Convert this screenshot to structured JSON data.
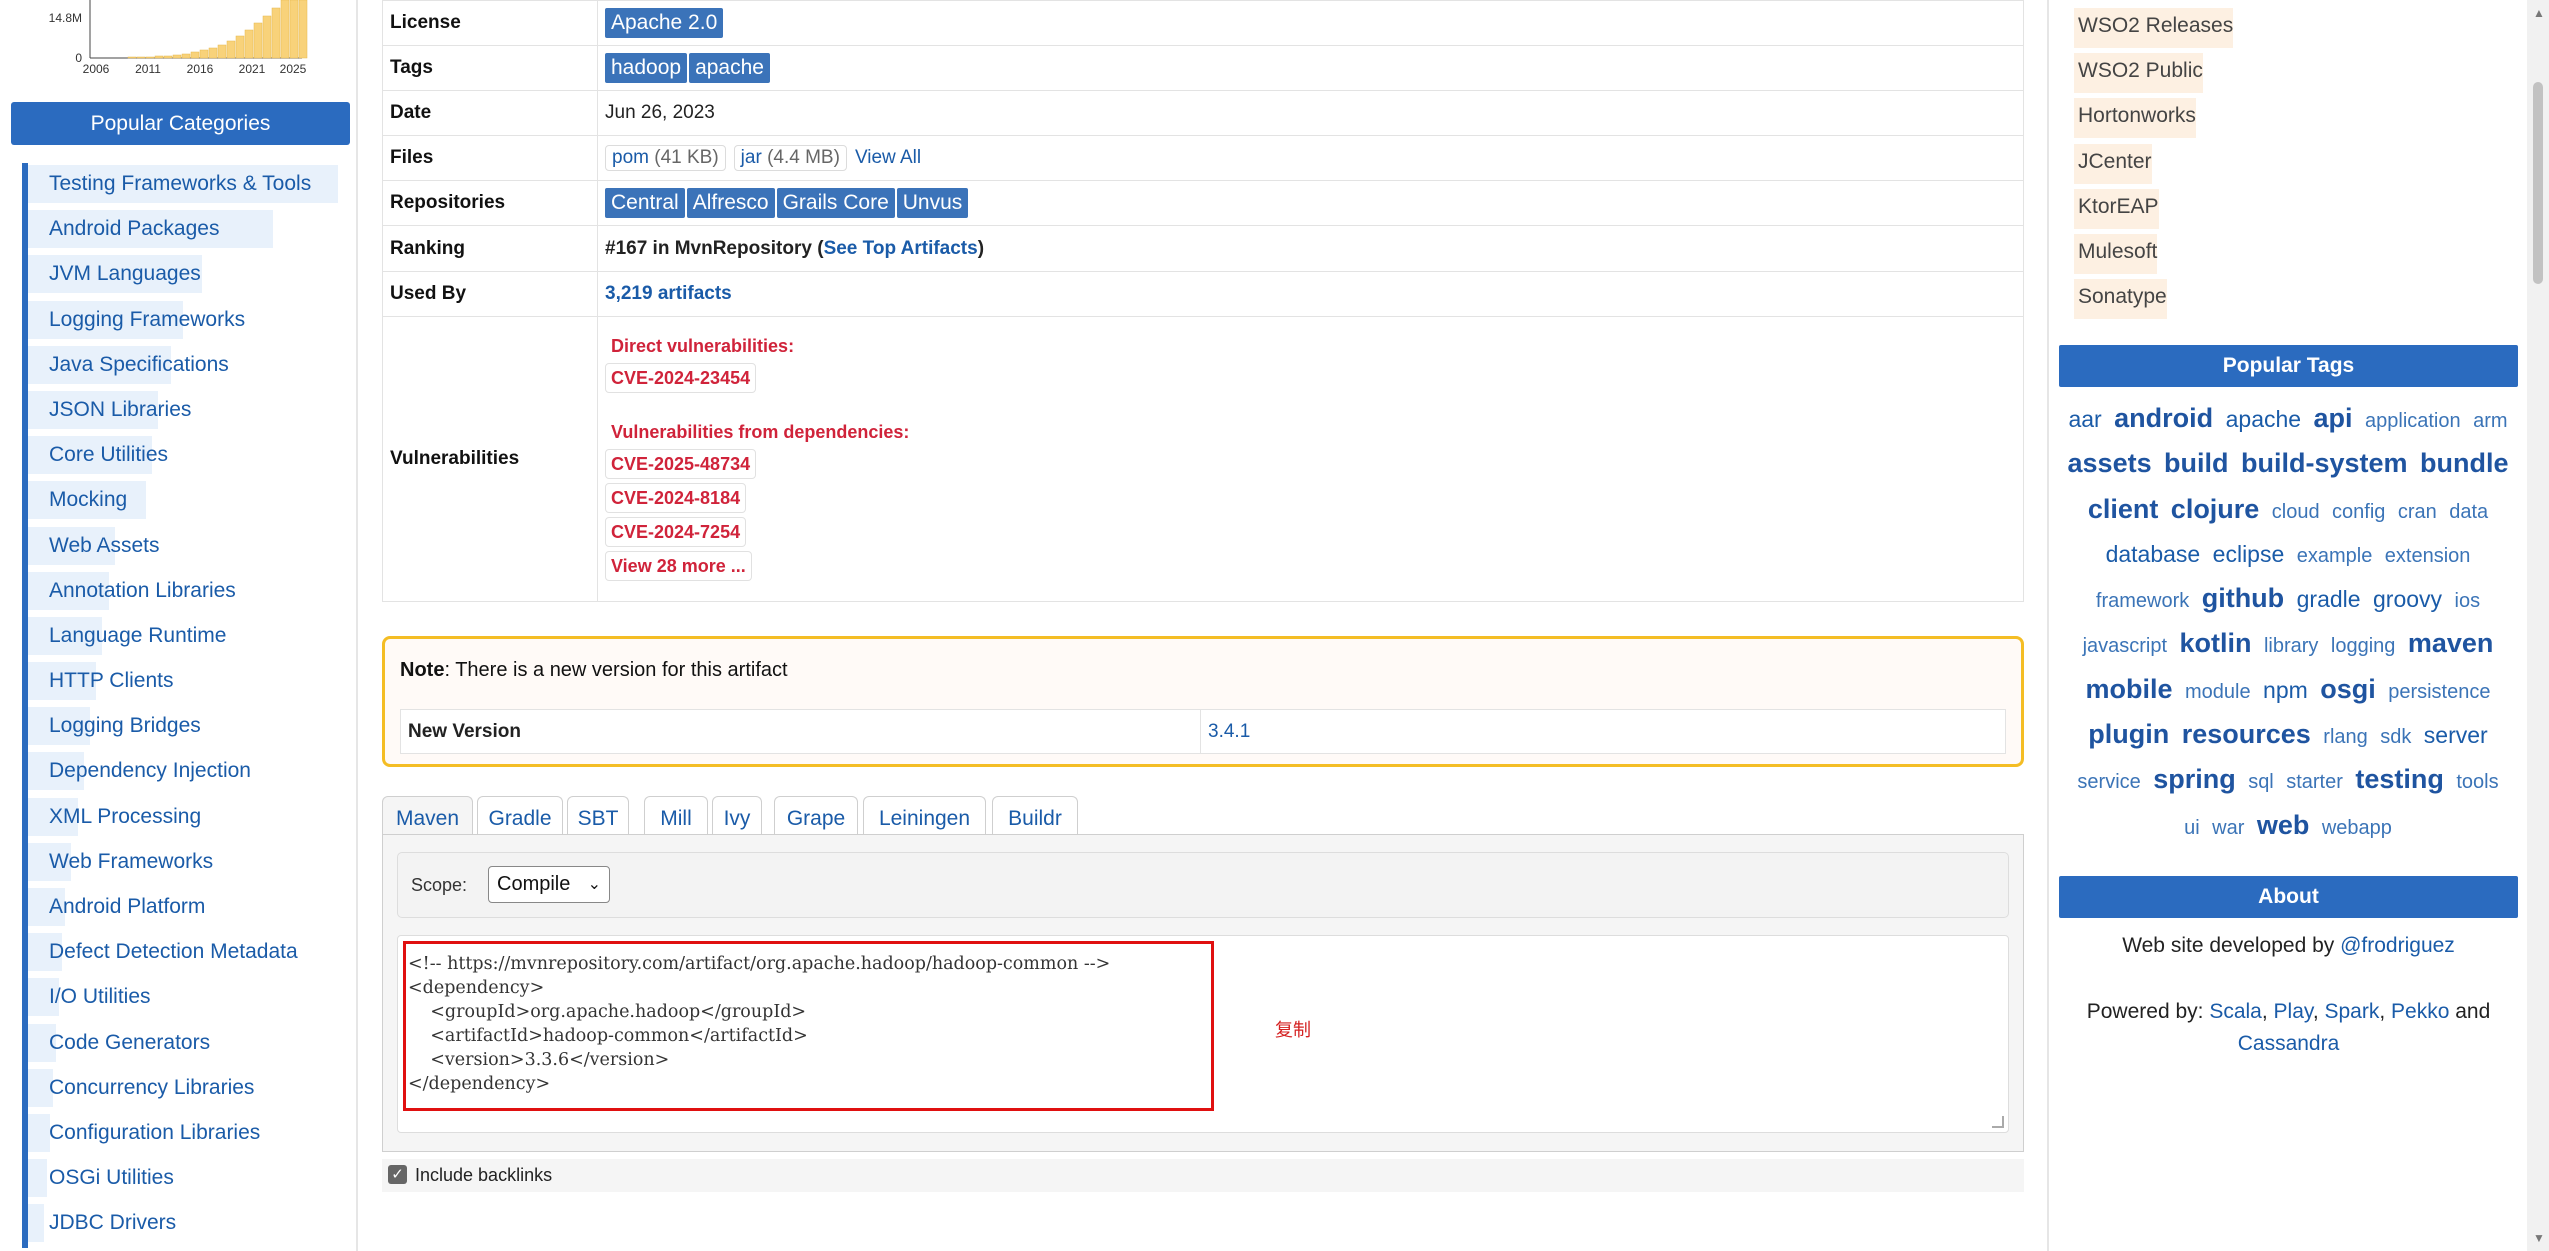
{
  "chart": {
    "ytick_top": "14.8M",
    "ytick_bottom": "0",
    "xticks": [
      "2006",
      "2011",
      "2016",
      "2021",
      "2025"
    ]
  },
  "sidebar": {
    "header": "Popular Categories",
    "items": [
      {
        "label": "Testing Frameworks & Tools",
        "weight": 1.0
      },
      {
        "label": "Android Packages",
        "weight": 0.79
      },
      {
        "label": "JVM Languages",
        "weight": 0.56
      },
      {
        "label": "Logging Frameworks",
        "weight": 0.5
      },
      {
        "label": "Java Specifications",
        "weight": 0.46
      },
      {
        "label": "JSON Libraries",
        "weight": 0.42
      },
      {
        "label": "Core Utilities",
        "weight": 0.4
      },
      {
        "label": "Mocking",
        "weight": 0.38
      },
      {
        "label": "Web Assets",
        "weight": 0.28
      },
      {
        "label": "Annotation Libraries",
        "weight": 0.26
      },
      {
        "label": "Language Runtime",
        "weight": 0.24
      },
      {
        "label": "HTTP Clients",
        "weight": 0.22
      },
      {
        "label": "Logging Bridges",
        "weight": 0.2
      },
      {
        "label": "Dependency Injection",
        "weight": 0.18
      },
      {
        "label": "XML Processing",
        "weight": 0.16
      },
      {
        "label": "Web Frameworks",
        "weight": 0.14
      },
      {
        "label": "Android Platform",
        "weight": 0.12
      },
      {
        "label": "Defect Detection Metadata",
        "weight": 0.11
      },
      {
        "label": "I/O Utilities",
        "weight": 0.1
      },
      {
        "label": "Code Generators",
        "weight": 0.09
      },
      {
        "label": "Concurrency Libraries",
        "weight": 0.08
      },
      {
        "label": "Configuration Libraries",
        "weight": 0.07
      },
      {
        "label": "OSGi Utilities",
        "weight": 0.06
      },
      {
        "label": "JDBC Drivers",
        "weight": 0.05
      }
    ]
  },
  "info": {
    "license_key": "License",
    "license_value": "Apache 2.0",
    "tags_key": "Tags",
    "tags": [
      "hadoop",
      "apache"
    ],
    "date_key": "Date",
    "date_value": "Jun 26, 2023",
    "files_key": "Files",
    "files": [
      {
        "name": "pom",
        "size": "(41 KB)"
      },
      {
        "name": "jar",
        "size": "(4.4 MB)"
      }
    ],
    "view_all": "View All",
    "repos_key": "Repositories",
    "repos": [
      "Central",
      "Alfresco",
      "Grails Core",
      "Unvus"
    ],
    "ranking_key": "Ranking",
    "ranking_prefix": "#167 in MvnRepository (",
    "ranking_link": "See Top Artifacts",
    "ranking_suffix": ")",
    "usedby_key": "Used By",
    "usedby_value": "3,219 artifacts",
    "vuln_key": "Vulnerabilities",
    "direct_title": "Direct vulnerabilities:",
    "direct": [
      "CVE-2024-23454"
    ],
    "deps_title": "Vulnerabilities from dependencies:",
    "deps": [
      "CVE-2025-48734",
      "CVE-2024-8184",
      "CVE-2024-7254"
    ],
    "view_more": "View 28 more ..."
  },
  "note": {
    "bold": "Note",
    "text": ": There is a new version for this artifact",
    "new_version_key": "New Version",
    "new_version_value": "3.4.1"
  },
  "tabs": [
    "Maven",
    "Gradle",
    "SBT",
    "Mill",
    "Ivy",
    "Grape",
    "Leiningen",
    "Buildr"
  ],
  "scope": {
    "label": "Scope:",
    "value": "Compile"
  },
  "code": "<!-- https://mvnrepository.com/artifact/org.apache.hadoop/hadoop-common -->\n<dependency>\n    <groupId>org.apache.hadoop</groupId>\n    <artifactId>hadoop-common</artifactId>\n    <version>3.3.6</version>\n</dependency>",
  "copy_label": "复制",
  "backlinks_label": "Include backlinks",
  "right": {
    "repos": [
      "WSO2 Releases",
      "WSO2 Public",
      "Hortonworks",
      "JCenter",
      "KtorEAP",
      "Mulesoft",
      "Sonatype"
    ],
    "tags_header": "Popular Tags",
    "tags": [
      {
        "t": "aar",
        "s": 2
      },
      {
        "t": "android",
        "s": 3
      },
      {
        "t": "apache",
        "s": 2
      },
      {
        "t": "api",
        "s": 3
      },
      {
        "t": "application",
        "s": 1
      },
      {
        "t": "arm",
        "s": 1
      },
      {
        "t": "assets",
        "s": 3
      },
      {
        "t": "build",
        "s": 3
      },
      {
        "t": "build-system",
        "s": 3
      },
      {
        "t": "bundle",
        "s": 3
      },
      {
        "t": "client",
        "s": 3
      },
      {
        "t": "clojure",
        "s": 3
      },
      {
        "t": "cloud",
        "s": 1
      },
      {
        "t": "config",
        "s": 1
      },
      {
        "t": "cran",
        "s": 1
      },
      {
        "t": "data",
        "s": 1
      },
      {
        "t": "database",
        "s": 2
      },
      {
        "t": "eclipse",
        "s": 2
      },
      {
        "t": "example",
        "s": 1
      },
      {
        "t": "extension",
        "s": 1
      },
      {
        "t": "framework",
        "s": 1
      },
      {
        "t": "github",
        "s": 3
      },
      {
        "t": "gradle",
        "s": 2
      },
      {
        "t": "groovy",
        "s": 2
      },
      {
        "t": "ios",
        "s": 1
      },
      {
        "t": "javascript",
        "s": 1
      },
      {
        "t": "kotlin",
        "s": 3
      },
      {
        "t": "library",
        "s": 1
      },
      {
        "t": "logging",
        "s": 1
      },
      {
        "t": "maven",
        "s": 3
      },
      {
        "t": "mobile",
        "s": 3
      },
      {
        "t": "module",
        "s": 1
      },
      {
        "t": "npm",
        "s": 2
      },
      {
        "t": "osgi",
        "s": 3
      },
      {
        "t": "persistence",
        "s": 1
      },
      {
        "t": "plugin",
        "s": 3
      },
      {
        "t": "resources",
        "s": 3
      },
      {
        "t": "rlang",
        "s": 1
      },
      {
        "t": "sdk",
        "s": 1
      },
      {
        "t": "server",
        "s": 2
      },
      {
        "t": "service",
        "s": 1
      },
      {
        "t": "spring",
        "s": 3
      },
      {
        "t": "sql",
        "s": 1
      },
      {
        "t": "starter",
        "s": 1
      },
      {
        "t": "testing",
        "s": 3
      },
      {
        "t": "tools",
        "s": 1
      },
      {
        "t": "ui",
        "s": 1
      },
      {
        "t": "war",
        "s": 1
      },
      {
        "t": "web",
        "s": 3
      },
      {
        "t": "webapp",
        "s": 1
      }
    ],
    "about_header": "About",
    "about_text": "Web site developed by ",
    "about_link": "@frodriguez",
    "powered_prefix": "Powered by: ",
    "powered_links": [
      "Scala",
      "Play",
      "Spark",
      "Pekko"
    ],
    "powered_and": " and",
    "powered_last": "Cassandra"
  }
}
